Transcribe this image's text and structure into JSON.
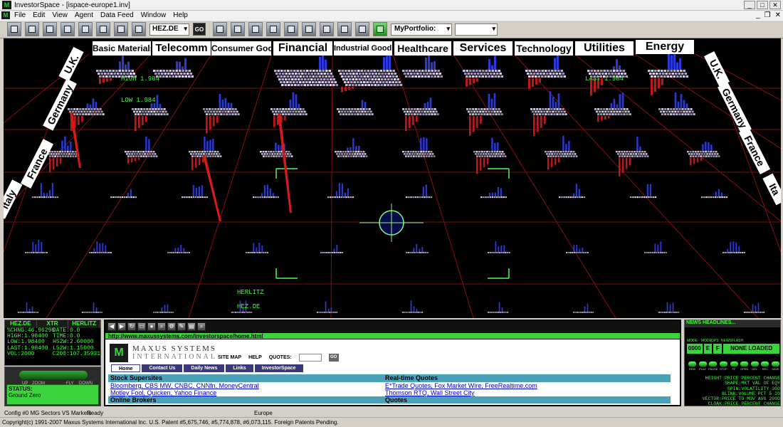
{
  "window": {
    "title": "InvestorSpace - [ispace-europe1.inv]"
  },
  "menu": [
    "File",
    "Edit",
    "View",
    "Agent",
    "Data Feed",
    "Window",
    "Help"
  ],
  "toolbar": {
    "ticker": "HEZ.DE",
    "go": "GO",
    "portfolio": "MyPortfolio:"
  },
  "sectors": [
    "Basic Materials",
    "Telecomm",
    "Consumer Goods",
    "Financial",
    "Industrial Goods",
    "Healthcare",
    "Services",
    "Technology",
    "Utilities",
    "Energy"
  ],
  "countries_left": [
    "U.K.",
    "Germany",
    "France",
    "Italy"
  ],
  "countries_right": [
    "U.K.",
    "Germany",
    "France",
    "Ita"
  ],
  "scene_labels": {
    "high": "HIGH 1.984",
    "low": "LOW 1.984",
    "last": "LAST 1.984",
    "herlitz": "HERLITZ",
    "hez": "HEZ.DE"
  },
  "quote_panel": {
    "tabs": [
      "HEZ.DE",
      "XTR",
      "HERLITZ"
    ],
    "rows": [
      [
        "%CHNG:46.96296",
        "DATE:0.0"
      ],
      [
        "HIGH:1.98400",
        "TIME:0.0"
      ],
      [
        "LOW:1.98400",
        "H52W:2.60000"
      ],
      [
        "LAST:1.98400",
        "L52W:1.15000"
      ],
      [
        "VOL:2000",
        "C200:107.35931"
      ]
    ]
  },
  "nav_panel": {
    "up": "UP",
    "zoom": "ZOOM",
    "fly": "FLY",
    "down": "DOWN",
    "status_label": "STATUS:",
    "status_value": "Ground Zero"
  },
  "browser": {
    "url": "http://www.maxussystems.com/investorspace/home.html",
    "company": "MAXUS SYSTEMS",
    "company_sub": "INTERNATIONAL",
    "links": [
      "SITE MAP",
      "HELP",
      "QUOTES:"
    ],
    "go": "GO",
    "tabs": [
      "Home",
      "Contact Us",
      "Daily News",
      "Links",
      "InvestorSpace"
    ],
    "left_heading": "Stock Supersites",
    "left_links_1": [
      "Bloomberg",
      "CBS MW",
      "CNBC",
      "CNNfn",
      "MoneyCentral"
    ],
    "left_links_2": [
      "Motley Fool",
      "Quicken",
      "Yahoo Finance"
    ],
    "left_heading_2": "Online Brokers",
    "right_heading": "Real-time Quotes",
    "right_links_1": [
      "E*Trade Quotes",
      "Fox Market Wire",
      "FreeRealtime.com"
    ],
    "right_links_2": [
      "Thomson RTQ",
      "Wall Street City"
    ],
    "right_heading_2": "Quotes"
  },
  "news": {
    "header": "NEWS HEADLINES...",
    "mode_labels": [
      "MODE",
      "MODE",
      "OPS",
      "NEWSFLASH"
    ],
    "mode_values": [
      "0000",
      "E",
      "F",
      "NONE LOADED"
    ],
    "buttons": [
      "REW",
      "PLAY",
      "PAUSE",
      "STOP",
      "FF",
      "OPEN",
      "DEL",
      "REC",
      "SAVE"
    ],
    "legend": [
      "HEIGHT:PRICE PERCENT CHANGE",
      "SHAPE:MKT VAL OF EQY",
      "SPIN:VOLATILITY 30D",
      "BLINK:VOLUME PCT 5 20",
      "VECTOR:PRICE TO MOV AVG 200D",
      "CLOAK:PRICE PERCENT CHANGE"
    ]
  },
  "statusbar": {
    "config": "Config #0 MG Sectors VS Markets",
    "ready": "Ready",
    "region": "Europe"
  },
  "copyright": "Copyright(c) 1991-2007 Maxus Systems International Inc. U.S. Patent #5,675,746, #5,774,878, #6,073,115. Foreign Patents Pending."
}
